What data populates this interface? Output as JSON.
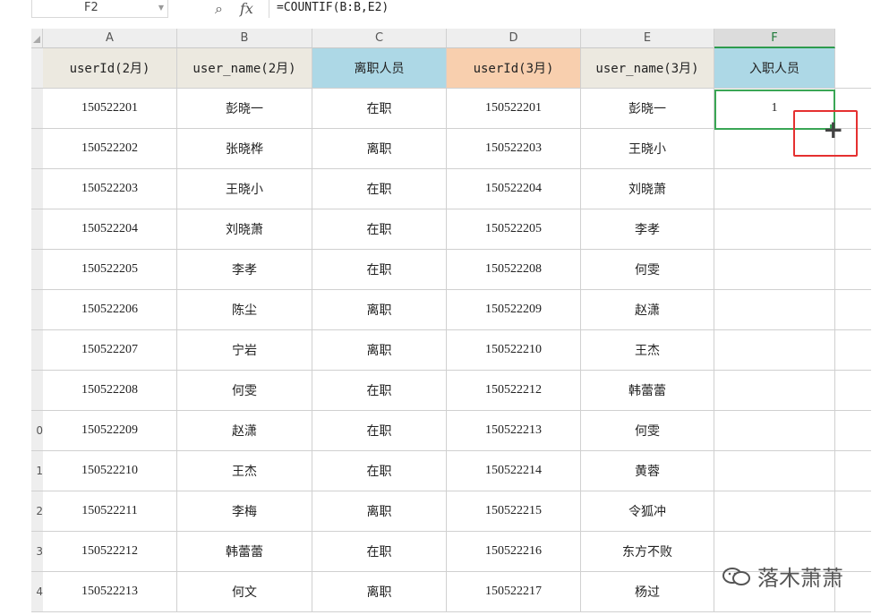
{
  "formula_bar": {
    "cell_ref": "F2",
    "formula": "=COUNTIF(B:B,E2)"
  },
  "columns": [
    "A",
    "B",
    "C",
    "D",
    "E",
    "F"
  ],
  "active_column": "F",
  "row_numbers": [
    "",
    "",
    "",
    "",
    "",
    "",
    "",
    "",
    "",
    "0",
    "1",
    "2",
    "3",
    "4"
  ],
  "header_row": [
    "userId(2月)",
    "user_name(2月)",
    "离职人员",
    "userId(3月)",
    "user_name(3月)",
    "入职人员"
  ],
  "rows": [
    [
      "150522201",
      "彭晓一",
      "在职",
      "150522201",
      "彭晓一",
      "1"
    ],
    [
      "150522202",
      "张晓桦",
      "离职",
      "150522203",
      "王晓小",
      ""
    ],
    [
      "150522203",
      "王晓小",
      "在职",
      "150522204",
      "刘晓萧",
      ""
    ],
    [
      "150522204",
      "刘晓萧",
      "在职",
      "150522205",
      "李孝",
      ""
    ],
    [
      "150522205",
      "李孝",
      "在职",
      "150522208",
      "何雯",
      ""
    ],
    [
      "150522206",
      "陈尘",
      "离职",
      "150522209",
      "赵潇",
      ""
    ],
    [
      "150522207",
      "宁岩",
      "离职",
      "150522210",
      "王杰",
      ""
    ],
    [
      "150522208",
      "何雯",
      "在职",
      "150522212",
      "韩蕾蕾",
      ""
    ],
    [
      "150522209",
      "赵潇",
      "在职",
      "150522213",
      "何雯",
      ""
    ],
    [
      "150522210",
      "王杰",
      "在职",
      "150522214",
      "黄蓉",
      ""
    ],
    [
      "150522211",
      "李梅",
      "离职",
      "150522215",
      "令狐冲",
      ""
    ],
    [
      "150522212",
      "韩蕾蕾",
      "在职",
      "150522216",
      "东方不败",
      ""
    ],
    [
      "150522213",
      "何文",
      "离职",
      "150522217",
      "杨过",
      ""
    ]
  ],
  "watermark": "落木萧萧",
  "colors": {
    "selection": "#3aa655",
    "highlight_box": "#e53030",
    "header_a": "#ece9e0",
    "header_c": "#add8e6",
    "header_d": "#f8cfae"
  }
}
